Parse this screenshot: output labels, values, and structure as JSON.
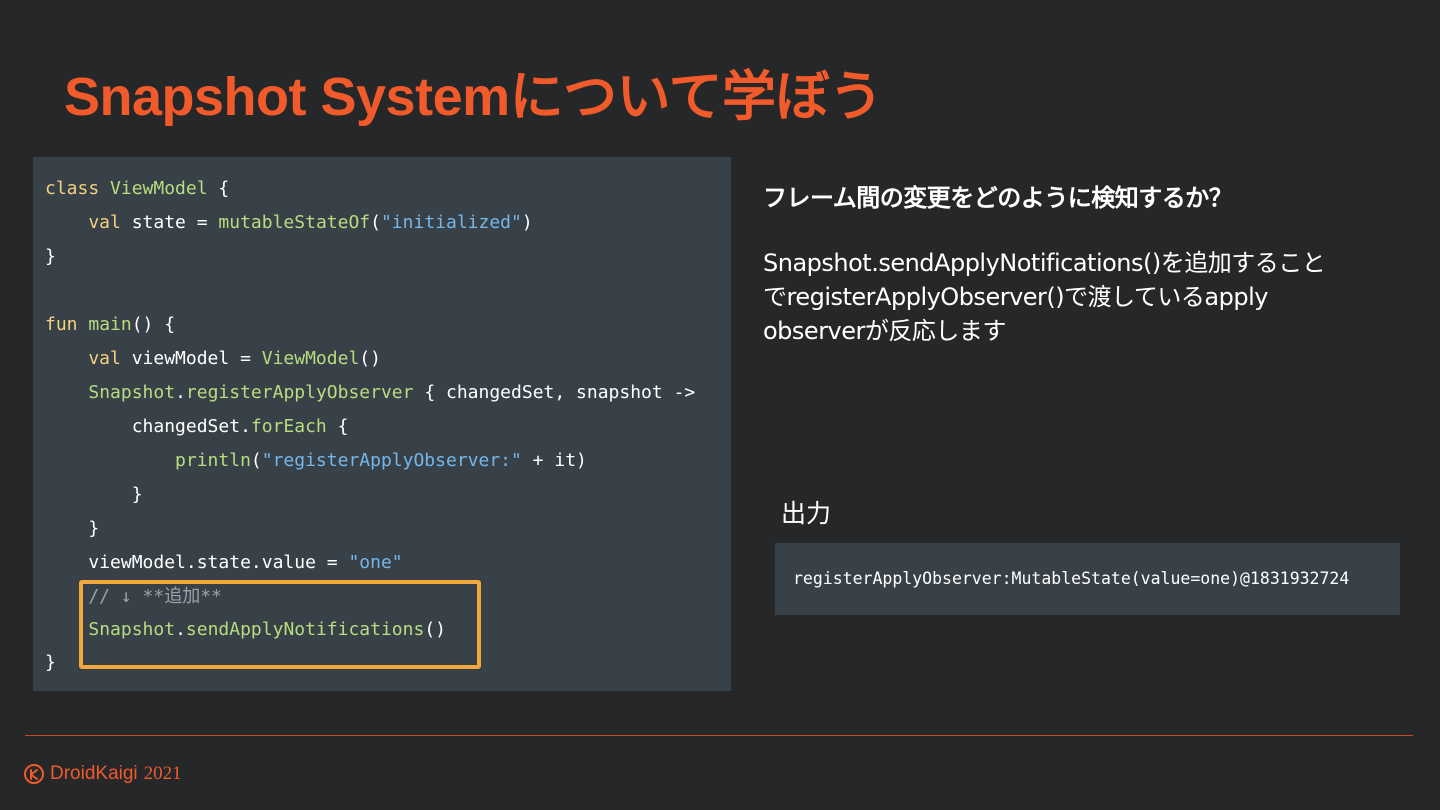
{
  "title": "Snapshot Systemについて学ぼう",
  "code": {
    "line1_k": "class ",
    "line1_f": "ViewModel",
    "line1_r": " {",
    "line2_k": "    val ",
    "line2_a": "state = ",
    "line2_f": "mutableStateOf",
    "line2_b": "(",
    "line2_s": "\"initialized\"",
    "line2_c": ")",
    "line3": "}",
    "line5_k": "fun ",
    "line5_f": "main",
    "line5_r": "() {",
    "line6_k": "    val ",
    "line6_a": "viewModel = ",
    "line6_f": "ViewModel",
    "line6_b": "()",
    "line7_a": "    ",
    "line7_f1": "Snapshot",
    "line7_b": ".",
    "line7_f2": "registerApplyObserver",
    "line7_c": " { changedSet, snapshot ->",
    "line8_a": "        changedSet.",
    "line8_f": "forEach",
    "line8_b": " {",
    "line9_a": "            ",
    "line9_f": "println",
    "line9_b": "(",
    "line9_s": "\"registerApplyObserver:\"",
    "line9_c": " + it)",
    "line10": "        }",
    "line11": "    }",
    "line12_a": "    viewModel.state.value = ",
    "line12_s": "\"one\"",
    "line13": "    // ↓ **追加**",
    "line14_a": "    ",
    "line14_f1": "Snapshot",
    "line14_b": ".",
    "line14_f2": "sendApplyNotifications",
    "line14_c": "()",
    "line15": "}"
  },
  "heading": "フレーム間の変更をどのように検知するか？",
  "description": {
    "line1": "Snapshot.sendApplyNotifications()を追加すること",
    "line2": "でregisterApplyObserver()で渡しているapply",
    "line3": "observerが反応します"
  },
  "output": {
    "label": "出力",
    "text": "registerApplyObserver:MutableState(value=one)@1831932724"
  },
  "footer": {
    "logo_icon": "droidkaigi-logo-icon",
    "brand": "DroidKaigi",
    "year": "2021"
  },
  "colors": {
    "accent": "#f15a2b",
    "highlight": "#f4a73a",
    "background": "#262729",
    "code_background": "#384148"
  }
}
